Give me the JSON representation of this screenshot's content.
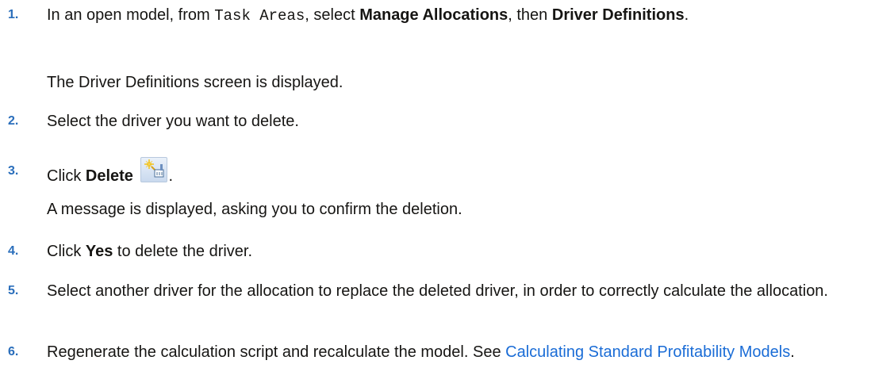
{
  "steps": [
    {
      "number": "1.",
      "parts": {
        "a": "In an open model, from ",
        "code": "Task Areas",
        "b": ", select ",
        "bold1": "Manage Allocations",
        "c": ", then ",
        "bold2": "Driver Definitions",
        "d": "."
      },
      "note": "The Driver Definitions screen is displayed."
    },
    {
      "number": "2.",
      "text": "Select the driver you want to delete."
    },
    {
      "number": "3.",
      "parts": {
        "a": "Click ",
        "bold": "Delete",
        "icon": "delete-driver-icon",
        "end": "."
      },
      "note": "A message is displayed, asking you to confirm the deletion."
    },
    {
      "number": "4.",
      "parts": {
        "a": "Click ",
        "bold": "Yes",
        "b": " to delete the driver."
      }
    },
    {
      "number": "5.",
      "text": "Select another driver for the allocation to replace the deleted driver, in order to correctly calculate the allocation."
    },
    {
      "number": "6.",
      "parts": {
        "a": "Regenerate the calculation script and recalculate the model. See ",
        "link": "Calculating Standard Profitability Models",
        "end": "."
      }
    }
  ],
  "colors": {
    "step_number": "#2a6ebb",
    "link": "#1a6cd6",
    "text": "#161513"
  }
}
